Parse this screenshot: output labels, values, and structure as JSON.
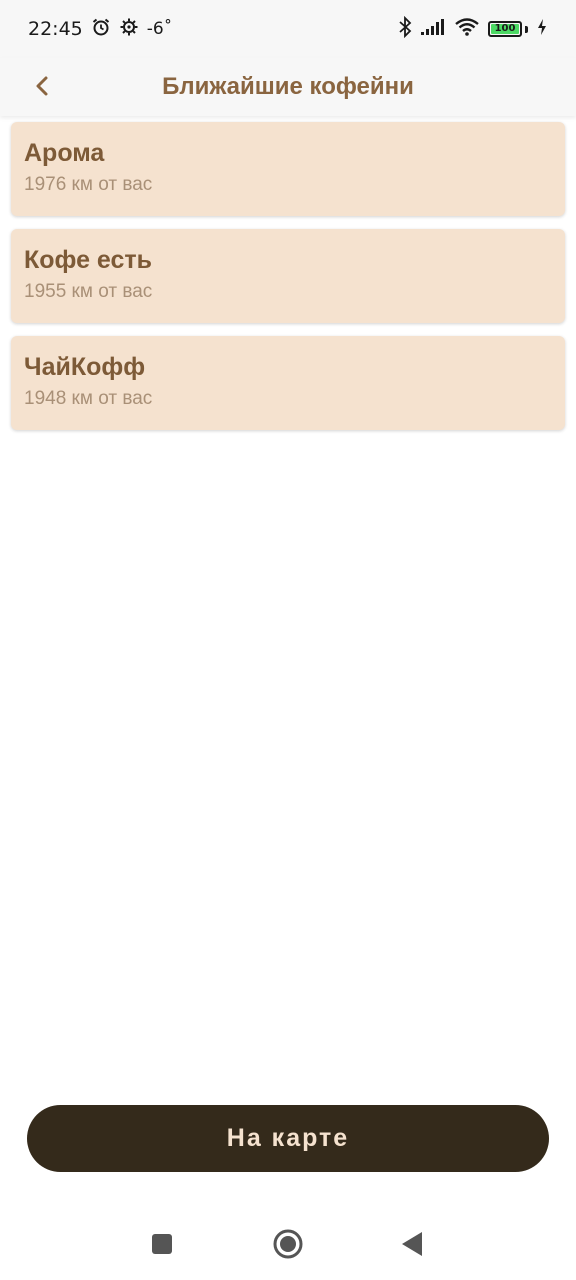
{
  "status_bar": {
    "time": "22:45",
    "temperature": "-6˚",
    "battery_level": "100"
  },
  "app_bar": {
    "title": "Ближайшие кофейни"
  },
  "shops": [
    {
      "name": "Арома",
      "distance": "1976 км от вас"
    },
    {
      "name": "Кофе есть",
      "distance": "1955 км от вас"
    },
    {
      "name": "ЧайКофф",
      "distance": "1948 км от вас"
    }
  ],
  "map_button": {
    "label": "На карте"
  },
  "colors": {
    "accent_brown": "#8a6540",
    "card_bg": "#f5e2cf",
    "button_bg": "#342a1b"
  },
  "icons": [
    "alarm-icon",
    "settings-icon",
    "bluetooth-icon",
    "signal-icon",
    "wifi-icon",
    "battery-icon",
    "charging-icon",
    "back-arrow-icon",
    "nav-recents-icon",
    "nav-home-icon",
    "nav-back-icon"
  ]
}
